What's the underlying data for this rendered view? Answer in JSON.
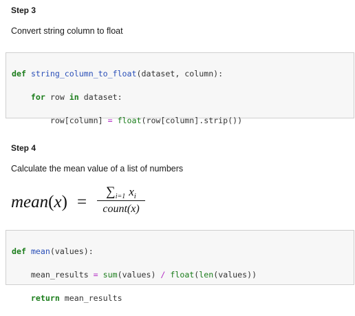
{
  "step3": {
    "title": "Step 3",
    "description": "Convert string column to float"
  },
  "step4": {
    "title": "Step 4",
    "description": "Calculate the mean value of a list of numbers"
  },
  "formula": {
    "lhs_name": "mean",
    "lhs_open": "(",
    "lhs_var": "x",
    "lhs_close": ")",
    "equals": "=",
    "sum_symbol": "∑",
    "sum_index": "i=1",
    "term": "x",
    "term_sub": "i",
    "denominator": "count(x)"
  },
  "code1": {
    "l1_kw": "def",
    "l1_fn": "string_column_to_float",
    "l1_rest": "(dataset, column):",
    "l2_indent": "    ",
    "l2_kw1": "for",
    "l2_mid": " row ",
    "l2_kw2": "in",
    "l2_rest": " dataset:",
    "l3_indent": "        ",
    "l3_lhs": "row[column] ",
    "l3_op": "=",
    "l3_sp": " ",
    "l3_bi": "float",
    "l3_rest": "(row[column].strip())"
  },
  "code2": {
    "l1_kw": "def",
    "l1_fn": "mean",
    "l1_rest": "(values):",
    "l2_indent": "    ",
    "l2_lhs": "mean_results ",
    "l2_op1": "=",
    "l2_sp1": " ",
    "l2_bi1": "sum",
    "l2_mid": "(values) ",
    "l2_op2": "/",
    "l2_sp2": " ",
    "l2_bi2": "float",
    "l2_p": "(",
    "l2_bi3": "len",
    "l2_rest": "(values))",
    "l3_indent": "    ",
    "l3_kw": "return",
    "l3_rest": " mean_results"
  }
}
